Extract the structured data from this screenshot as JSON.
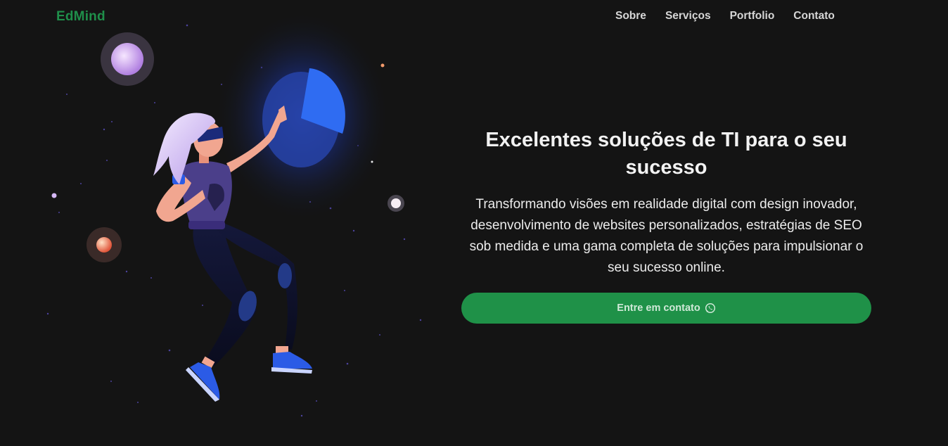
{
  "brand": {
    "name": "EdMind",
    "color": "#1f8f4a"
  },
  "nav": {
    "items": [
      {
        "label": "Sobre"
      },
      {
        "label": "Serviços"
      },
      {
        "label": "Portfolio"
      },
      {
        "label": "Contato"
      }
    ]
  },
  "hero": {
    "title": "Excelentes soluções de TI para o seu sucesso",
    "description": "Transformando visões em realidade digital com design inovador, desenvolvimento de websites personalizados, estratégias de SEO sob medida e uma gama completa de soluções para impulsionar o seu sucesso online.",
    "cta_label": "Entre em contato",
    "cta_icon": "whatsapp-icon",
    "cta_color": "#1f9148"
  },
  "illustration": {
    "subject": "woman-floating-in-space-touching-pie-chart"
  }
}
